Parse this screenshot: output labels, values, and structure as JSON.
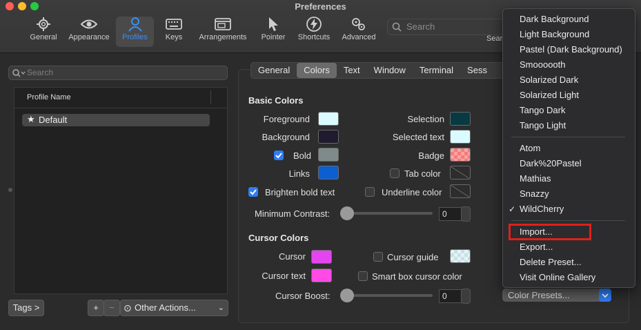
{
  "window": {
    "title": "Preferences"
  },
  "toolbar": {
    "items": [
      {
        "label": "General",
        "icon": "gear-icon"
      },
      {
        "label": "Appearance",
        "icon": "eye-icon"
      },
      {
        "label": "Profiles",
        "icon": "person-icon",
        "selected": true
      },
      {
        "label": "Keys",
        "icon": "keyboard-icon"
      },
      {
        "label": "Arrangements",
        "icon": "window-icon"
      },
      {
        "label": "Pointer",
        "icon": "pointer-icon"
      },
      {
        "label": "Shortcuts",
        "icon": "bolt-icon"
      },
      {
        "label": "Advanced",
        "icon": "gears-icon"
      }
    ],
    "search_placeholder": "Search",
    "search_truncated_label": "Sear"
  },
  "sidebar": {
    "search_placeholder": "Search",
    "column_header": "Profile Name",
    "profiles": [
      {
        "label": "Default",
        "starred": true
      }
    ],
    "tags_button": "Tags >",
    "add_button": "+",
    "remove_button": "−",
    "other_actions": "Other Actions..."
  },
  "tabs": [
    "General",
    "Colors",
    "Text",
    "Window",
    "Terminal",
    "Sess"
  ],
  "selected_tab": "Colors",
  "basic_colors": {
    "heading": "Basic Colors",
    "foreground": {
      "label": "Foreground",
      "color": "#dafbff"
    },
    "background": {
      "label": "Background",
      "color": "#1f1a2e"
    },
    "bold": {
      "label": "Bold",
      "color": "#7f8a8a",
      "checked": true
    },
    "links": {
      "label": "Links",
      "color": "#0b5fd1"
    },
    "selection": {
      "label": "Selection",
      "color": "#073a42"
    },
    "selected_text": {
      "label": "Selected text",
      "color": "#dafbff"
    },
    "badge": {
      "label": "Badge",
      "color": "#f57b7b"
    },
    "tab_color": {
      "label": "Tab color",
      "checked": false
    },
    "brighten_bold": {
      "label": "Brighten bold text",
      "checked": true
    },
    "underline_color": {
      "label": "Underline color",
      "checked": false
    },
    "min_contrast": {
      "label": "Minimum Contrast:",
      "value": "0",
      "level": 0
    }
  },
  "cursor_colors": {
    "heading": "Cursor Colors",
    "cursor": {
      "label": "Cursor",
      "color": "#e445f0"
    },
    "cursor_text": {
      "label": "Cursor text",
      "color": "#ff4ae6"
    },
    "cursor_guide": {
      "label": "Cursor guide",
      "checked": false
    },
    "smart_box": {
      "label": "Smart box cursor color",
      "checked": false
    },
    "cursor_boost": {
      "label": "Cursor Boost:",
      "value": "0",
      "level": 0
    }
  },
  "presets_menu": {
    "group1": [
      "Dark Background",
      "Light Background",
      "Pastel (Dark Background)",
      "Smoooooth",
      "Solarized Dark",
      "Solarized Light",
      "Tango Dark",
      "Tango Light"
    ],
    "group2": [
      "Atom",
      "Dark%20Pastel",
      "Mathias",
      "Snazzy",
      "WildCherry"
    ],
    "checked": "WildCherry",
    "group3": [
      "Import...",
      "Export...",
      "Delete Preset...",
      "Visit Online Gallery"
    ],
    "highlighted": "Import...",
    "button_label": "Color Presets...",
    "checkmark": "✓"
  }
}
